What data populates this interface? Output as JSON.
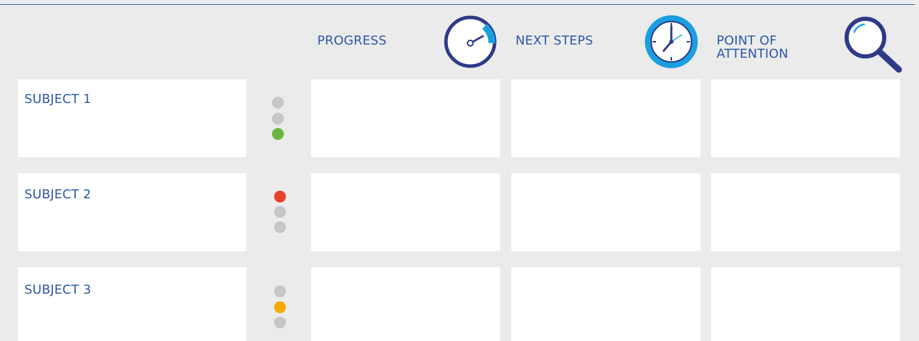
{
  "headers": {
    "progress": "PROGRESS",
    "next_steps": "NEXT STEPS",
    "point_of_attention": "POINT OF\nATTENTION"
  },
  "icons": {
    "progress": "gauge-icon",
    "next_steps": "clock-icon",
    "point_of_attention": "magnifier-icon"
  },
  "rows": [
    {
      "label": "SUBJECT 1",
      "status": "green"
    },
    {
      "label": "SUBJECT 2",
      "status": "red"
    },
    {
      "label": "SUBJECT 3",
      "status": "amber"
    }
  ],
  "colors": {
    "text": "#2d57a6",
    "red": "#e8412c",
    "amber": "#f2a900",
    "green": "#6db33f",
    "inactive": "#c6c6c6",
    "background": "#ebebeb",
    "accent_blue": "#1a9fe0",
    "navy": "#2e3a87"
  }
}
